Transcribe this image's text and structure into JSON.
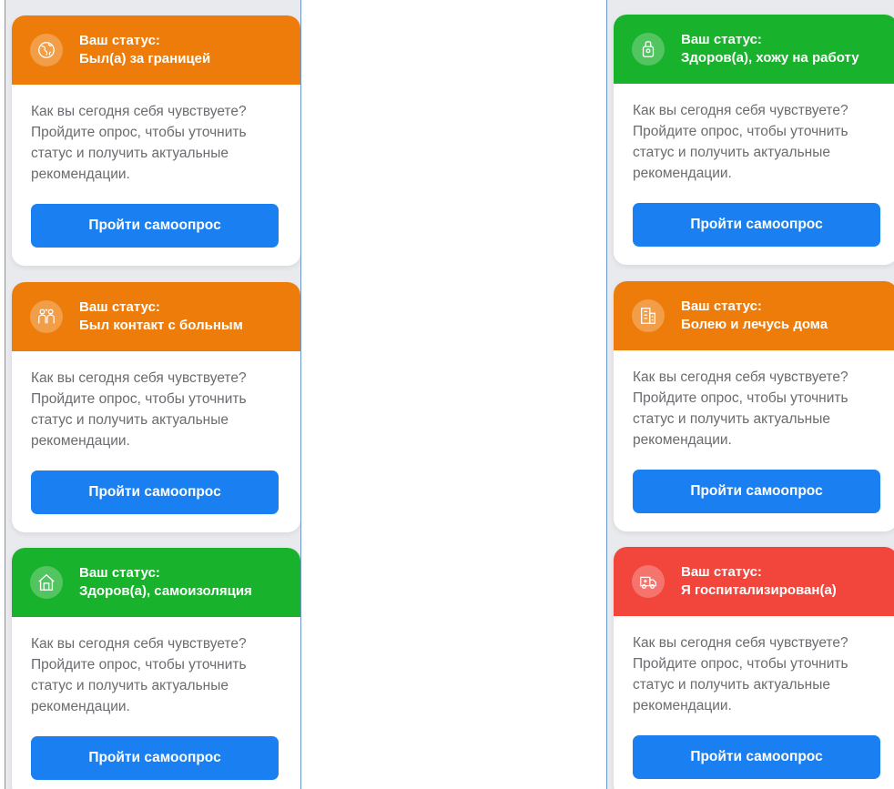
{
  "colors": {
    "orange": "#ee7c0a",
    "green": "#18b22c",
    "red": "#f2463c",
    "button": "#1a80f2"
  },
  "cards": [
    {
      "status_label": "Ваш статус:",
      "status_value": "Был(а) за границей",
      "icon": "globe-icon",
      "color": "orange",
      "text": "Как вы сегодня себя чувствуете? Пройдите опрос, чтобы уточнить статус и получить актуальные рекомендации.",
      "button": "Пройти самоопрос"
    },
    {
      "status_label": "Ваш статус:",
      "status_value": "Был контакт с больным",
      "icon": "people-contact-icon",
      "color": "orange",
      "text": "Как вы сегодня себя чувствуете? Пройдите опрос, чтобы уточнить статус и получить актуальные рекомендации.",
      "button": "Пройти самоопрос"
    },
    {
      "status_label": "Ваш статус:",
      "status_value": "Здоров(а), самоизоляция",
      "icon": "house-icon",
      "color": "green",
      "text": "Как вы сегодня себя чувствуете? Пройдите опрос, чтобы уточнить статус и получить актуальные рекомендации.",
      "button": "Пройти самоопрос"
    },
    {
      "status_label": "Ваш статус:",
      "status_value": "Здоров(а), хожу на работу",
      "icon": "badge-icon",
      "color": "green",
      "text": "Как вы сегодня себя чувствуете? Пройдите опрос, чтобы уточнить статус и получить актуальные рекомендации.",
      "button": "Пройти самоопрос"
    },
    {
      "status_label": "Ваш статус:",
      "status_value": "Болею и лечусь дома",
      "icon": "building-icon",
      "color": "orange",
      "text": "Как вы сегодня себя чувствуете? Пройдите опрос, чтобы уточнить статус и получить актуальные рекомендации.",
      "button": "Пройти самоопрос"
    },
    {
      "status_label": "Ваш статус:",
      "status_value": "Я госпитализирован(а)",
      "icon": "ambulance-icon",
      "color": "red",
      "text": "Как вы сегодня себя чувствуете? Пройдите опрос, чтобы уточнить статус и получить актуальные рекомендации.",
      "button": "Пройти самоопрос"
    }
  ]
}
